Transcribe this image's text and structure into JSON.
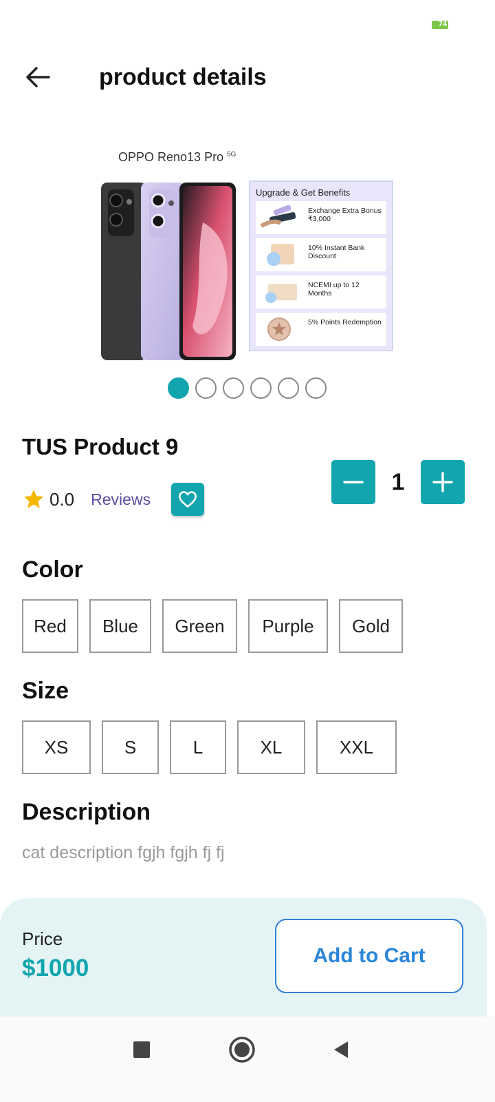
{
  "status_bar": {
    "battery": "74"
  },
  "app_bar": {
    "title": "product details"
  },
  "product_image": {
    "brand": "OPPO Reno13 Pro",
    "brand_sup": "5G",
    "benefits_title": "Upgrade & Get Benefits",
    "benefits": [
      {
        "text": "Exchange Extra Bonus ₹3,000"
      },
      {
        "text": "10% Instant Bank Discount"
      },
      {
        "text": "NCEMI up to 12 Months"
      },
      {
        "text": "5% Points Redemption"
      }
    ]
  },
  "carousel": {
    "count": 6,
    "active_index": 0
  },
  "product": {
    "name": "TUS Product 9",
    "rating": "0.0",
    "reviews_label": "Reviews",
    "quantity": "1"
  },
  "color": {
    "title": "Color",
    "options": [
      "Red",
      "Blue",
      "Green",
      "Purple",
      "Gold"
    ]
  },
  "size": {
    "title": "Size",
    "options": [
      "XS",
      "S",
      "L",
      "XL",
      "XXL"
    ]
  },
  "description": {
    "title": "Description",
    "text": "cat description fgjh fgjh fj fj"
  },
  "cart": {
    "price_label": "Price",
    "price": "$1000",
    "add_label": "Add to Cart"
  },
  "colors": {
    "accent": "#12a5ad",
    "cart_bg": "#e4f4f4",
    "link": "#5a4ea0",
    "add_to_cart_text": "#2a86d8"
  }
}
